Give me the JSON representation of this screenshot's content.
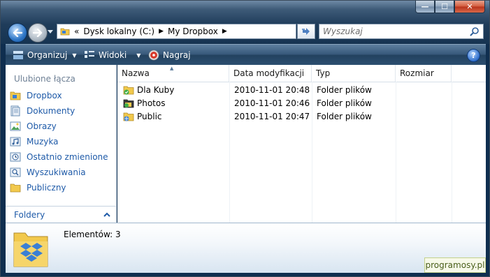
{
  "window": {
    "controls": {
      "minimize": "—",
      "maximize": "☐",
      "close": "✕"
    }
  },
  "address_bar": {
    "overflow": "«",
    "crumbs": [
      "Dysk lokalny (C:)",
      "My Dropbox"
    ]
  },
  "search": {
    "placeholder": "Wyszukaj"
  },
  "toolbar": {
    "organize": "Organizuj",
    "views": "Widoki",
    "burn": "Nagraj",
    "help": "?"
  },
  "nav_pane": {
    "title": "Ulubione łącza",
    "items": [
      {
        "label": "Dropbox",
        "icon": "dropbox-folder-icon"
      },
      {
        "label": "Dokumenty",
        "icon": "documents-icon"
      },
      {
        "label": "Obrazy",
        "icon": "pictures-icon"
      },
      {
        "label": "Muzyka",
        "icon": "music-icon"
      },
      {
        "label": "Ostatnio zmienione",
        "icon": "recent-icon"
      },
      {
        "label": "Wyszukiwania",
        "icon": "searches-icon"
      },
      {
        "label": "Publiczny",
        "icon": "public-folder-icon"
      }
    ],
    "folders_label": "Foldery"
  },
  "columns": [
    "Nazwa",
    "Data modyfikacji",
    "Typ",
    "Rozmiar"
  ],
  "files": [
    {
      "name": "Dla Kuby",
      "date": "2010-11-01 20:48",
      "type": "Folder plików"
    },
    {
      "name": "Photos",
      "date": "2010-11-01 20:46",
      "type": "Folder plików"
    },
    {
      "name": "Public",
      "date": "2010-11-01 20:47",
      "type": "Folder plików"
    }
  ],
  "details": {
    "count": "Elementów: 3"
  },
  "watermark": "programosy.pl"
}
